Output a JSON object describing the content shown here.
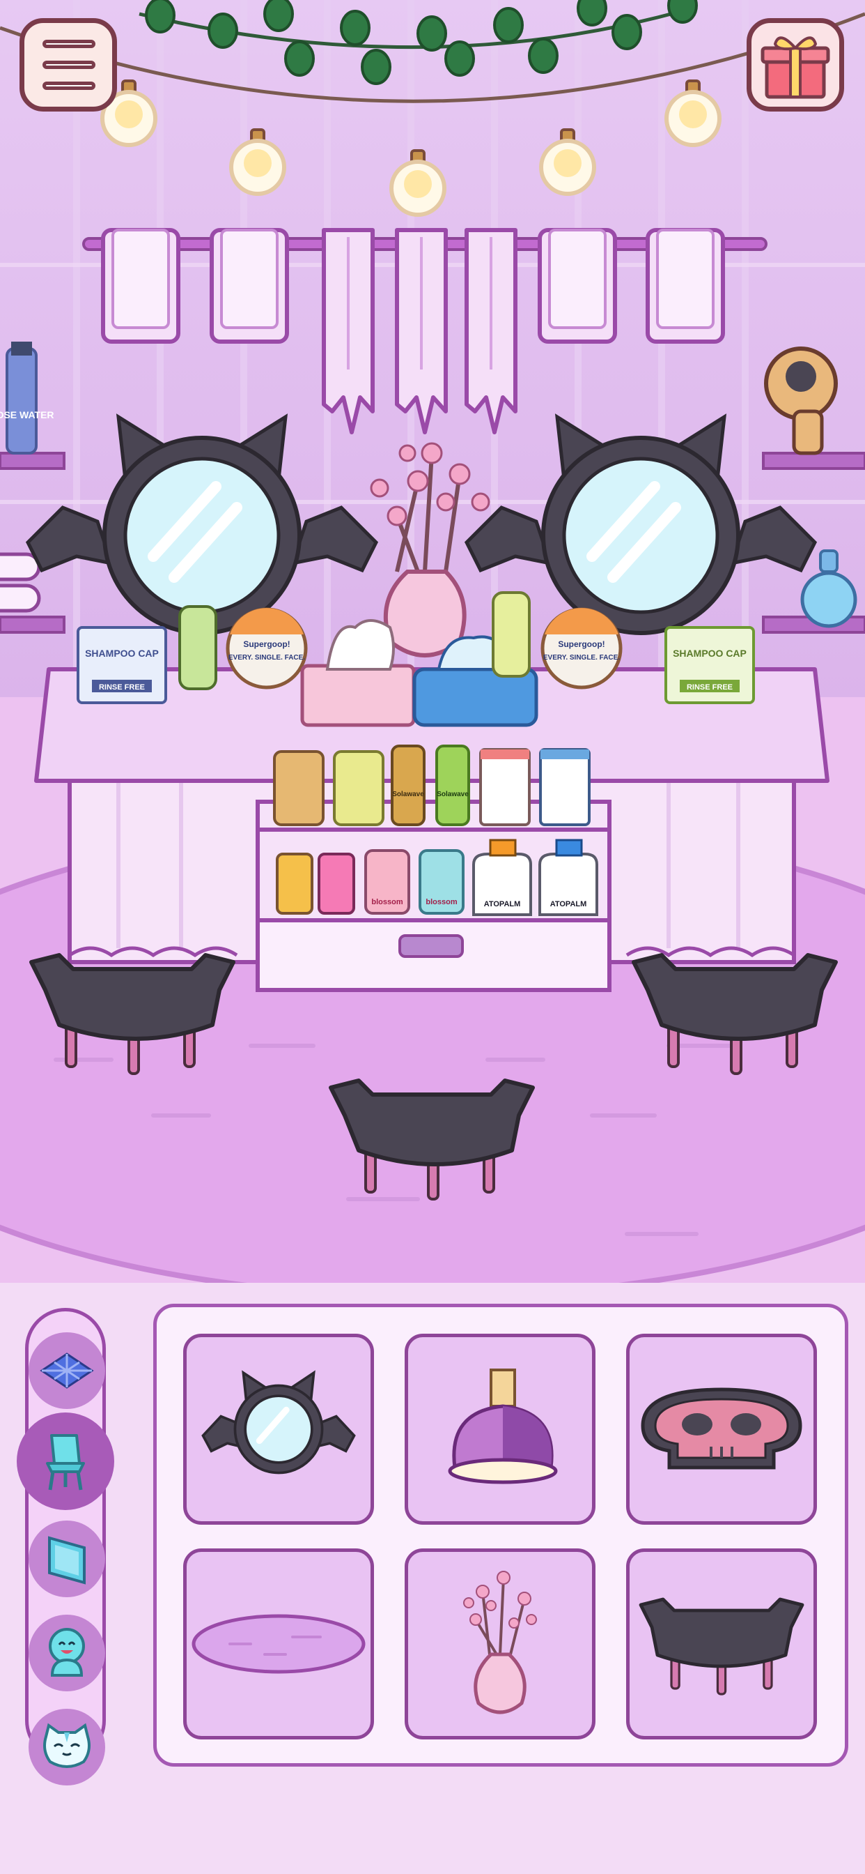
{
  "hud": {
    "menu_icon": "hamburger-menu-icon",
    "gift_icon": "gift-box-icon"
  },
  "scene": {
    "product_labels": {
      "shampoo_cap": "SHAMPOO CAP",
      "rinse_free": "RINSE FREE",
      "supergoop": "Supergoop!",
      "every_single_face": "EVERY. SINGLE. FACE.",
      "rose_water": "ROSE WATER",
      "sol_de": "Solawave",
      "blossom": "blossom",
      "atopalm": "ATOPALM"
    }
  },
  "categories": [
    {
      "icon": "floor-tile-icon",
      "active": false
    },
    {
      "icon": "chair-icon",
      "active": true
    },
    {
      "icon": "wall-panel-icon",
      "active": false
    },
    {
      "icon": "character-icon",
      "active": false
    },
    {
      "icon": "cat-pet-icon",
      "active": false
    }
  ],
  "items": [
    {
      "icon": "bat-mirror-icon"
    },
    {
      "icon": "purple-lamp-icon"
    },
    {
      "icon": "skull-rug-icon"
    },
    {
      "icon": "oval-rug-icon"
    },
    {
      "icon": "flower-vase-icon"
    },
    {
      "icon": "bat-stool-icon"
    }
  ],
  "colors": {
    "wall": "#dcb6ec",
    "floor": "#e3a8ec",
    "accent": "#a458b3",
    "slot_bg": "#e9c3f3",
    "mirror_frame": "#4a4553"
  }
}
